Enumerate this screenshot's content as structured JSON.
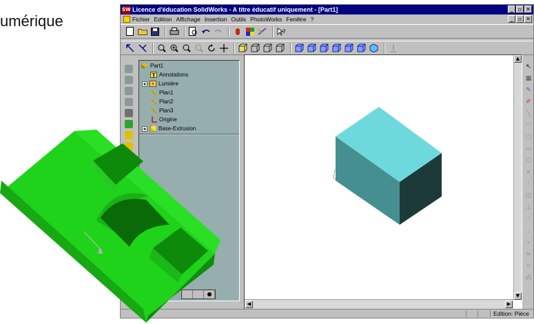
{
  "slide": {
    "partial_title": "umérique"
  },
  "window": {
    "logo_text": "SW",
    "title": "Licence d'éducation SolidWorks - A titre éducatif uniquement - [Part1]",
    "buttons": [
      "_",
      "▫",
      "✕"
    ]
  },
  "menu": {
    "items": [
      "Fichier",
      "Edition",
      "Affichage",
      "Insertion",
      "Outils",
      "PhotoWorks",
      "Fenêtre",
      "?"
    ]
  },
  "toolbar1": {
    "icons": [
      "new-doc-icon",
      "open-folder-icon",
      "save-icon",
      "print-icon",
      "print-preview-icon",
      "undo-icon",
      "redo-icon",
      "rebuild-icon",
      "color-icon",
      "sketch-icon",
      "help-icon"
    ]
  },
  "toolbar2": {
    "icons": [
      "select-icon",
      "measure-icon",
      "zoom-fit-icon",
      "zoom-in-icon",
      "zoom-area-icon",
      "zoom-out-icon",
      "rotate-icon",
      "pan-icon",
      "wireframe-icon",
      "hidden-lines-icon",
      "shaded-icon",
      "front-view-icon",
      "back-view-icon",
      "left-view-icon",
      "right-view-icon",
      "top-view-icon",
      "isometric-icon",
      "normal-to-icon"
    ]
  },
  "tree": {
    "items": [
      {
        "label": "Part1",
        "icon": "part-icon"
      },
      {
        "label": "Annotations",
        "icon": "annotation-icon"
      },
      {
        "label": "Lumière",
        "icon": "light-icon",
        "expandable": true
      },
      {
        "label": "Plan1",
        "icon": "plane-icon"
      },
      {
        "label": "Plan2",
        "icon": "plane-icon"
      },
      {
        "label": "Plan3",
        "icon": "plane-icon"
      },
      {
        "label": "Origine",
        "icon": "origin-icon"
      },
      {
        "label": "Base-Extrusion",
        "icon": "extrusion-icon",
        "expandable": true
      }
    ]
  },
  "status": {
    "text": "Edition: Pièce"
  },
  "colors": {
    "title_bar": "#000080",
    "tree_bg": "#96aeae",
    "box_top": "#6ed9dc",
    "box_left": "#468f91",
    "box_right": "#1d3a3b",
    "part_green": "#1fd21a"
  }
}
